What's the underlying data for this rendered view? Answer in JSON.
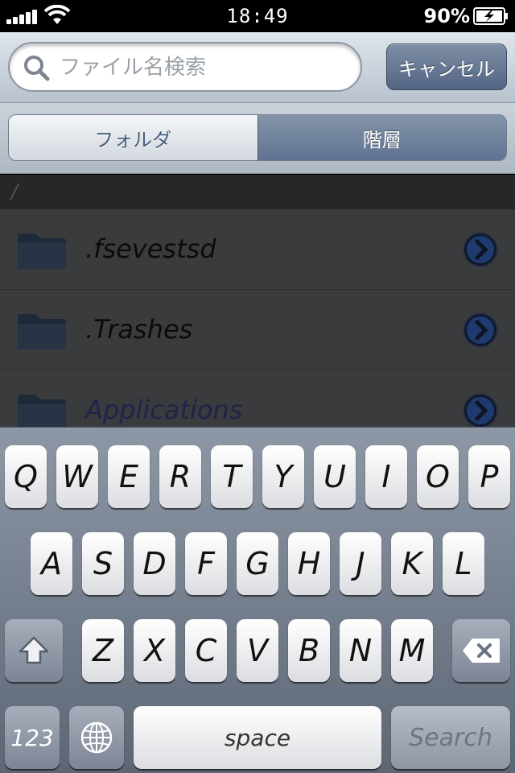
{
  "status_bar": {
    "time": "18:49",
    "battery_percent": "90%"
  },
  "search": {
    "placeholder": "ファイル名検索",
    "value": "",
    "cancel_label": "キャンセル"
  },
  "segments": {
    "folder_label": "フォルダ",
    "hierarchy_label": "階層",
    "selected": "階層"
  },
  "path": "/",
  "files": [
    {
      "name": ".fsevestsd",
      "icon": "folder-icon"
    },
    {
      "name": ".Trashes",
      "icon": "folder-icon"
    },
    {
      "name": "Applications",
      "icon": "folder-icon"
    }
  ],
  "keyboard": {
    "row1": [
      "Q",
      "W",
      "E",
      "R",
      "T",
      "Y",
      "U",
      "I",
      "O",
      "P"
    ],
    "row2": [
      "A",
      "S",
      "D",
      "F",
      "G",
      "H",
      "J",
      "K",
      "L"
    ],
    "row3": [
      "Z",
      "X",
      "C",
      "V",
      "B",
      "N",
      "M"
    ],
    "numbers_label": "123",
    "space_label": "space",
    "search_label": "Search"
  },
  "colors": {
    "accent_button": "#5f7290",
    "list_background": "#3a3b3d",
    "keyboard_background": "#717b89"
  }
}
